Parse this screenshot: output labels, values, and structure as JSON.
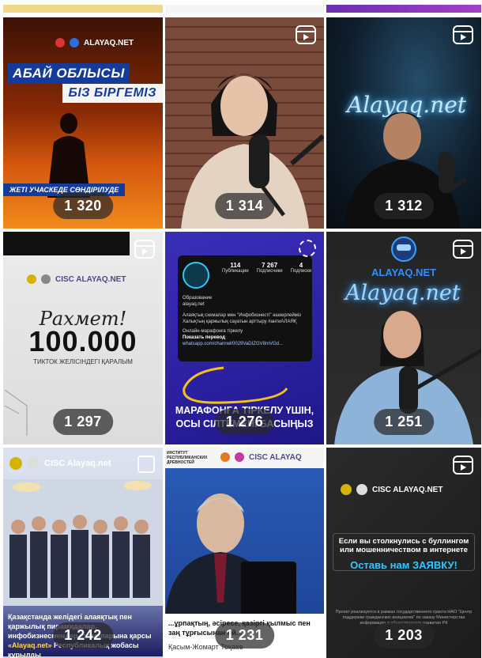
{
  "grid": {
    "posts": [
      {
        "count": "1 320",
        "type": "image",
        "title_line1": "АБАЙ ОБЛЫСЫ",
        "title_line2": "БІЗ БІРГЕМІЗ",
        "band": "ЖЕТІ УЧАСКЕДЕ СӨНДІРІЛУДЕ",
        "logo": "ALAYAQ.NET"
      },
      {
        "count": "1 314",
        "type": "reel"
      },
      {
        "count": "1 312",
        "type": "reel",
        "neon": "Alayaq.net"
      },
      {
        "count": "1 297",
        "type": "reel",
        "rahmet": "Рахмет!",
        "big": "100.000",
        "sub": "ТИКТОК ЖЕЛІСІНДЕГІ ҚАРАЛЫМ",
        "logos": "CISC  ALAYAQ.NET"
      },
      {
        "count": "1 276",
        "type": "carousel",
        "stats": [
          {
            "value": "114",
            "label": "Публикации"
          },
          {
            "value": "7 267",
            "label": "Подписчики"
          },
          {
            "value": "4",
            "label": "Подписки"
          }
        ],
        "bio_title": "Образование",
        "handle": "alayaq.net",
        "bio_line1": "Алаяқтық схемалар мен \"Инфобизнесті\" әшкерлейміз",
        "bio_line2": "Халықтың қаржылық сауатын арттыру #антиАЛАЯҚ",
        "marathon": "Онлайн-марафонға тіркелу",
        "translate": "Показать перевод",
        "link": "whatsapp.com/channel/0029VaDIZGV8mVGd...",
        "cta": "МАРАФОНҒА ТІРКЕЛУ ҮШІН, ОСЫ СІЛТЕМЕНІ БАСЫҢЫЗ"
      },
      {
        "count": "1 251",
        "type": "reel",
        "brand": "ALAYAQ.NET",
        "neon": "Alayaq.net"
      },
      {
        "count": "1 242",
        "type": "carousel",
        "logos": "CISC  Alayaq.net",
        "caption1": "Қазақстанда желідегі алаяқтық пен қаржылық пирамидалар, инфобизнесмендер схемаларына қарсы",
        "caption2": "«Alayaq.net»",
        "caption3": "Республикалық жобасы құрылды"
      },
      {
        "count": "1 231",
        "type": "carousel",
        "header": "ИНСТИТУТ РЕСПУБЛИКАНСКИХ ДРЕВНОСТЕЙ",
        "logos": "CISC  ALAYAQ",
        "caption1": "...ұрпақтың, әсіресе, қазіргі қылмыс пен заң тұрғысынан ой...",
        "caption2": "Қасым-Жомарт Тоқаев"
      },
      {
        "count": "1 203",
        "type": "reel",
        "logos": "CISC  ALAYAQ.NET",
        "line1": "Если вы столкнулись с буллингом или мошенничеством в интернете",
        "cta": "Оставь нам ЗАЯВКУ!",
        "fine": "Проект реализуется в рамках государственного гранта НАО \"Центр поддержки гражданских инициатив\" по заказу Министерства информации и общественного развития РК"
      }
    ]
  },
  "colors": {
    "brand_blue": "#143a9a",
    "count_bg": "#282828",
    "accent_cyan": "#35c6ff"
  }
}
